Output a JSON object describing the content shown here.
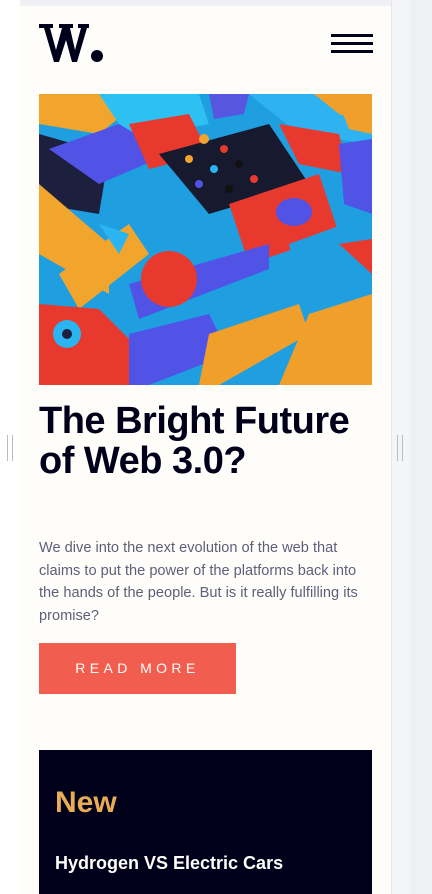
{
  "header": {
    "logo_text": "W.",
    "menu_icon": "hamburger-icon"
  },
  "hero": {
    "image_alt": "Colorful abstract 3D geometric blocks"
  },
  "article": {
    "title": "The Bright Future of Web 3.0?",
    "description": "We dive into the next evolution of the web that claims to put the power of the platforms back into the hands of the people. But is it really fulfilling its promise?",
    "cta_label": "READ MORE"
  },
  "new_section": {
    "heading": "New",
    "items": [
      {
        "title": "Hydrogen VS Electric Cars"
      }
    ]
  },
  "colors": {
    "background": "#fffdfa",
    "dark_navy": "#00001a",
    "accent_red": "#f15e50",
    "accent_orange": "#e9ab53",
    "body_text": "#5d5f79"
  }
}
